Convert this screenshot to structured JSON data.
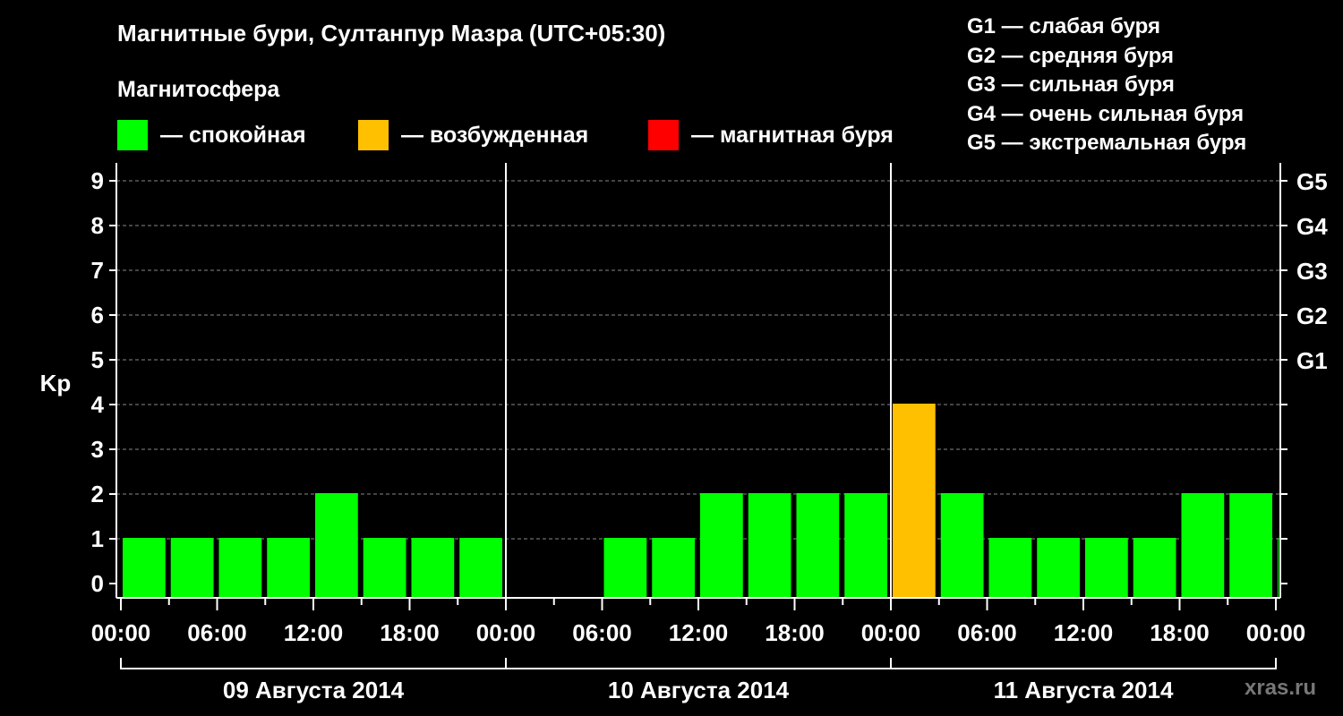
{
  "title": "Магнитные бури, Султанпур Мазра (UTC+05:30)",
  "subtitle": "Магнитосфера",
  "legend": [
    {
      "color": "#00ff00",
      "label": "— спокойная"
    },
    {
      "color": "#ffc000",
      "label": "— возбужденная"
    },
    {
      "color": "#ff0000",
      "label": "— магнитная буря"
    }
  ],
  "g_legend": [
    "G1 — слабая буря",
    "G2 — средняя буря",
    "G3 — сильная буря",
    "G4 — очень сильная буря",
    "G5 — экстремальная буря"
  ],
  "watermark": "xras.ru",
  "chart_data": {
    "type": "bar",
    "ylabel": "Kp",
    "ylim": [
      0,
      9
    ],
    "yticks": [
      0,
      1,
      2,
      3,
      4,
      5,
      6,
      7,
      8,
      9
    ],
    "right_axis_labels": [
      {
        "kp": 5,
        "label": "G1"
      },
      {
        "kp": 6,
        "label": "G2"
      },
      {
        "kp": 7,
        "label": "G3"
      },
      {
        "kp": 8,
        "label": "G4"
      },
      {
        "kp": 9,
        "label": "G5"
      }
    ],
    "xtick_labels": [
      "00:00",
      "06:00",
      "12:00",
      "18:00",
      "00:00",
      "06:00",
      "12:00",
      "18:00",
      "00:00",
      "06:00",
      "12:00",
      "18:00",
      "00:00"
    ],
    "days": [
      "09 Августа 2014",
      "10 Августа 2014",
      "11 Августа 2014"
    ],
    "bar_hours": 3,
    "bars": [
      {
        "start_hour": 0,
        "kp": 1,
        "level": "quiet"
      },
      {
        "start_hour": 3,
        "kp": 1,
        "level": "quiet"
      },
      {
        "start_hour": 6,
        "kp": 1,
        "level": "quiet"
      },
      {
        "start_hour": 9,
        "kp": 1,
        "level": "quiet"
      },
      {
        "start_hour": 12,
        "kp": 2,
        "level": "quiet"
      },
      {
        "start_hour": 15,
        "kp": 1,
        "level": "quiet"
      },
      {
        "start_hour": 18,
        "kp": 1,
        "level": "quiet"
      },
      {
        "start_hour": 21,
        "kp": 1,
        "level": "quiet"
      },
      {
        "start_hour": 30,
        "kp": 1,
        "level": "quiet"
      },
      {
        "start_hour": 33,
        "kp": 1,
        "level": "quiet"
      },
      {
        "start_hour": 36,
        "kp": 2,
        "level": "quiet"
      },
      {
        "start_hour": 39,
        "kp": 2,
        "level": "quiet"
      },
      {
        "start_hour": 42,
        "kp": 2,
        "level": "quiet"
      },
      {
        "start_hour": 45,
        "kp": 2,
        "level": "quiet"
      },
      {
        "start_hour": 48,
        "kp": 4,
        "level": "excited"
      },
      {
        "start_hour": 51,
        "kp": 2,
        "level": "quiet"
      },
      {
        "start_hour": 54,
        "kp": 1,
        "level": "quiet"
      },
      {
        "start_hour": 57,
        "kp": 1,
        "level": "quiet"
      },
      {
        "start_hour": 60,
        "kp": 1,
        "level": "quiet"
      },
      {
        "start_hour": 63,
        "kp": 1,
        "level": "quiet"
      },
      {
        "start_hour": 66,
        "kp": 2,
        "level": "quiet"
      },
      {
        "start_hour": 69,
        "kp": 2,
        "level": "quiet"
      },
      {
        "start_hour": 72,
        "kp": 1,
        "level": "quiet"
      }
    ],
    "level_colors": {
      "quiet": "#00ff00",
      "excited": "#ffc000",
      "storm": "#ff0000"
    },
    "grid": true
  }
}
